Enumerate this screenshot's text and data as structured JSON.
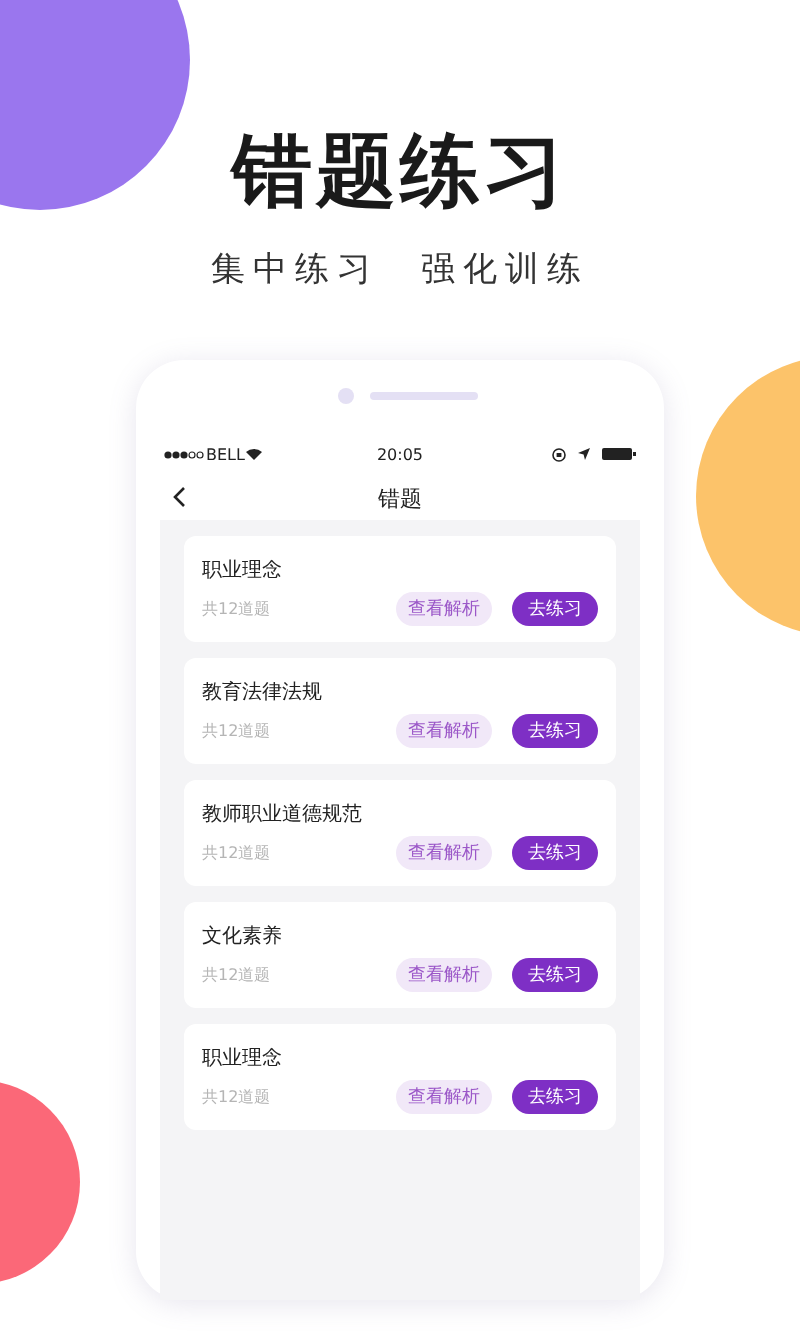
{
  "headline": "错题练习",
  "subheadline": "集中练习　强化训练",
  "phone": {
    "status_bar": {
      "carrier": "BELL",
      "time": "20:05"
    },
    "nav": {
      "title": "错题"
    },
    "items": [
      {
        "title": "职业理念",
        "count": "共12道题",
        "review": "查看解析",
        "practice": "去练习"
      },
      {
        "title": "教育法律法规",
        "count": "共12道题",
        "review": "查看解析",
        "practice": "去练习"
      },
      {
        "title": "教师职业道德规范",
        "count": "共12道题",
        "review": "查看解析",
        "practice": "去练习"
      },
      {
        "title": "文化素养",
        "count": "共12道题",
        "review": "查看解析",
        "practice": "去练习"
      },
      {
        "title": "职业理念",
        "count": "共12道题",
        "review": "查看解析",
        "practice": "去练习"
      }
    ]
  }
}
